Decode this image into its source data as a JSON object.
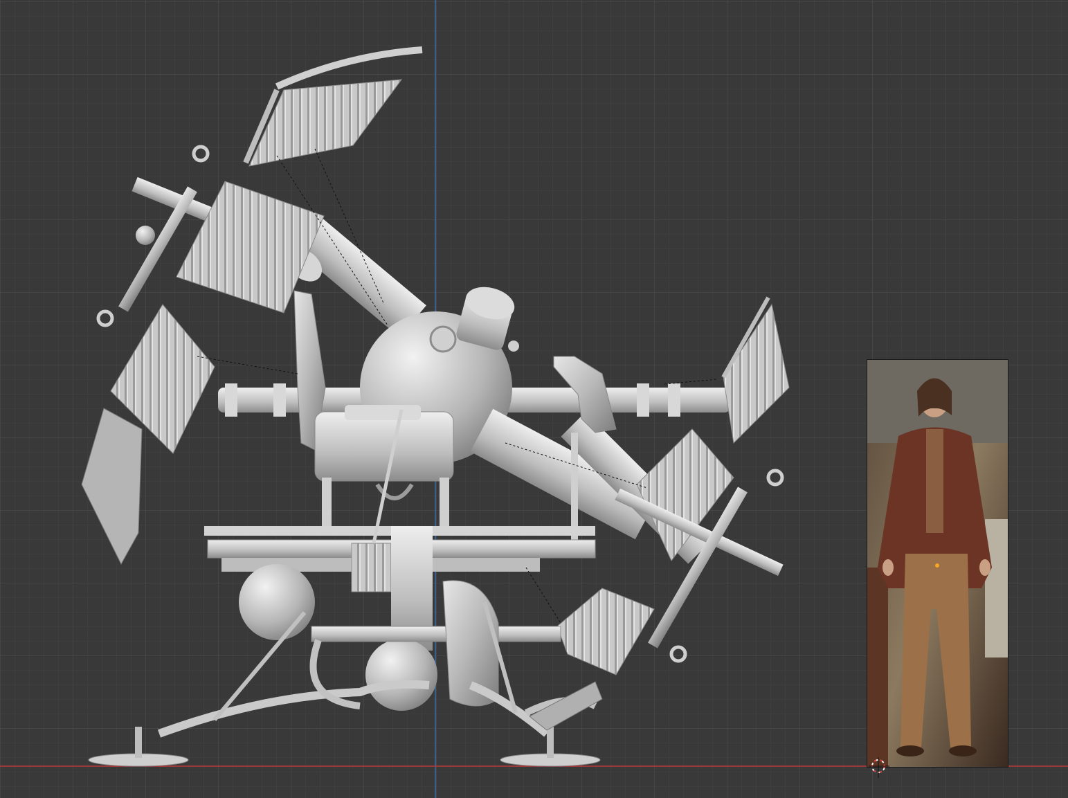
{
  "app": {
    "name": "3D Viewport"
  },
  "viewport": {
    "background_color": "#393939",
    "grid_minor_color": "#454545",
    "grid_major_color": "#4d4d4d",
    "axis_x_color": "#c0392b",
    "axis_z_color": "#3a6ea5"
  },
  "scene": {
    "model": {
      "name": "time-machine-model",
      "color": "#c8c8c8",
      "shade_color": "#8a8a8a"
    },
    "reference_image": {
      "name": "character-reference-photo"
    },
    "cursor": {
      "name": "3d-cursor-icon"
    }
  }
}
